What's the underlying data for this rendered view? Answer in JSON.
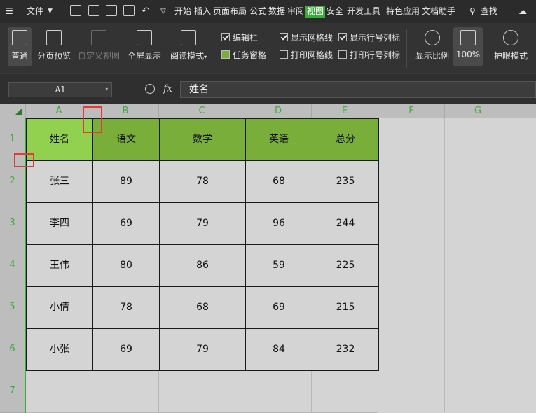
{
  "menubar": {
    "file": "文件",
    "tabs": [
      "开始",
      "插入",
      "页面布局",
      "公式",
      "数据",
      "审阅",
      "视图",
      "安全",
      "开发工具",
      "特色应用",
      "文档助手"
    ],
    "active_tab": "视图",
    "search": "查找"
  },
  "ribbon": {
    "normal": "普通",
    "page_break_preview": "分页预览",
    "custom_view": "自定义视图",
    "full_screen": "全屏显示",
    "reading_mode": "阅读模式",
    "edit_bar": "编辑栏",
    "task_pane": "任务窗格",
    "show_gridlines": "显示网格线",
    "print_gridlines": "打印网格线",
    "show_headers": "显示行号列标",
    "print_headers": "打印行号列标",
    "zoom_ratio": "显示比例",
    "zoom_100": "100%",
    "eye_mode": "护眼模式"
  },
  "formula_bar": {
    "name_box": "A1",
    "fx": "fx",
    "content": "姓名"
  },
  "columns": [
    "A",
    "B",
    "C",
    "D",
    "E",
    "F",
    "G"
  ],
  "rows": [
    "1",
    "2",
    "3",
    "4",
    "5",
    "6",
    "7"
  ],
  "table": {
    "headers": [
      "姓名",
      "语文",
      "数学",
      "英语",
      "总分"
    ],
    "rows": [
      [
        "张三",
        "89",
        "78",
        "68",
        "235"
      ],
      [
        "李四",
        "69",
        "79",
        "96",
        "244"
      ],
      [
        "王伟",
        "80",
        "86",
        "59",
        "225"
      ],
      [
        "小倩",
        "78",
        "68",
        "69",
        "215"
      ],
      [
        "小张",
        "69",
        "79",
        "84",
        "232"
      ]
    ]
  },
  "colors": {
    "accent": "#3daa3d",
    "header_fill": "#7aae3a",
    "selected_header_fill": "#92d050",
    "highlight_box": "#e53935"
  }
}
